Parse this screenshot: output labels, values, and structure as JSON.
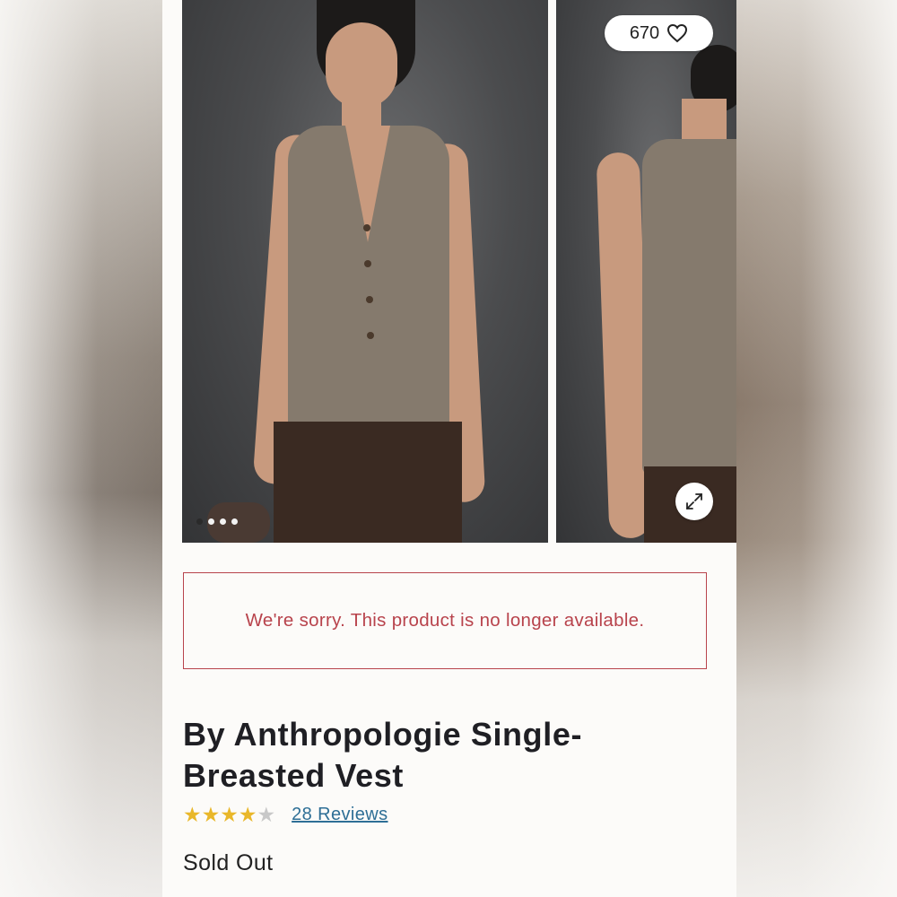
{
  "gallery": {
    "likes_count": "670",
    "dot_count": 4,
    "active_dot": 0,
    "image_front_alt": "Model wearing vest, front view",
    "image_back_alt": "Model wearing vest, back view"
  },
  "notice": {
    "message": "We're sorry. This product is no longer available."
  },
  "product": {
    "title": "By Anthropologie Single-Breasted Vest",
    "rating": 4,
    "rating_max": 5,
    "reviews_label": "28 Reviews",
    "availability": "Sold Out"
  },
  "colors": {
    "notice_red": "#b8434c",
    "star_gold": "#e9b72a",
    "link_blue": "#2e6f96"
  }
}
